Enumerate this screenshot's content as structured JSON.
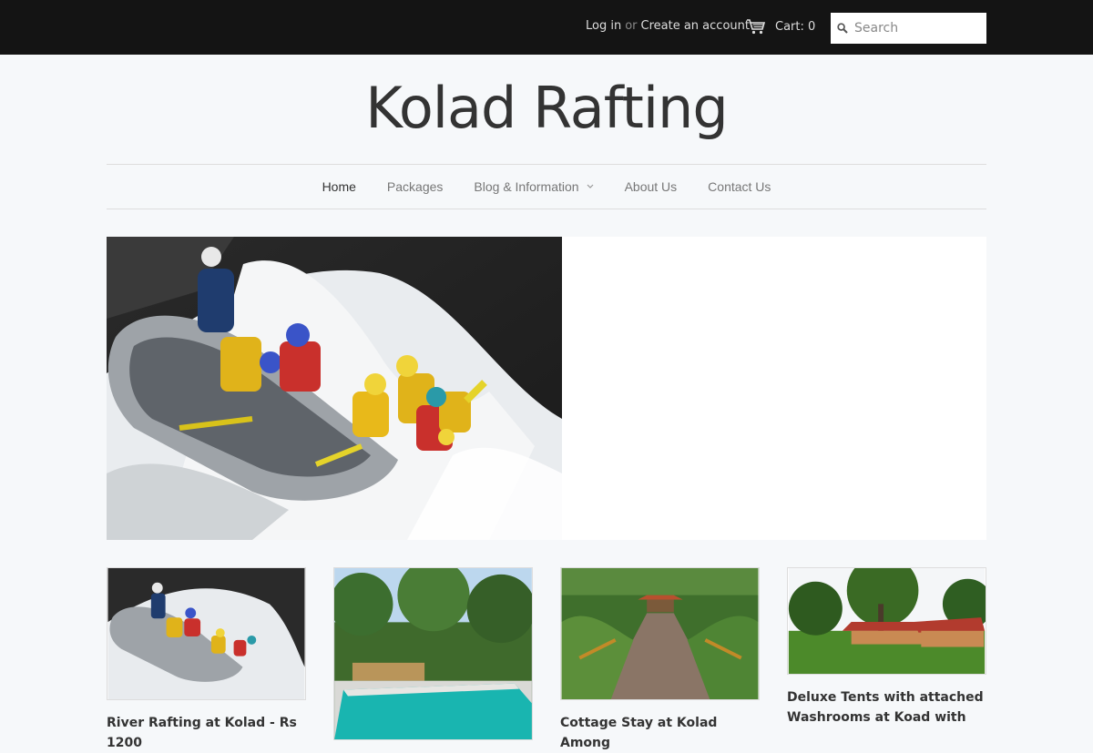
{
  "header": {
    "login_label": "Log in",
    "or_label": "or",
    "create_account_label": "Create an account",
    "cart_label": "Cart: 0",
    "search_placeholder": "Search"
  },
  "site": {
    "title": "Kolad Rafting"
  },
  "nav": {
    "items": [
      {
        "label": "Home"
      },
      {
        "label": "Packages"
      },
      {
        "label": "Blog & Information"
      },
      {
        "label": "About Us"
      },
      {
        "label": "Contact Us"
      }
    ]
  },
  "products": [
    {
      "title": "River Rafting at Kolad - Rs 1200"
    },
    {
      "title": ""
    },
    {
      "title": "Cottage Stay at Kolad Among"
    },
    {
      "title": "Deluxe Tents with attached Washrooms at Koad with"
    }
  ],
  "colors": {
    "topbar": "#141414",
    "background": "#f6f8fa",
    "text": "#333333"
  }
}
